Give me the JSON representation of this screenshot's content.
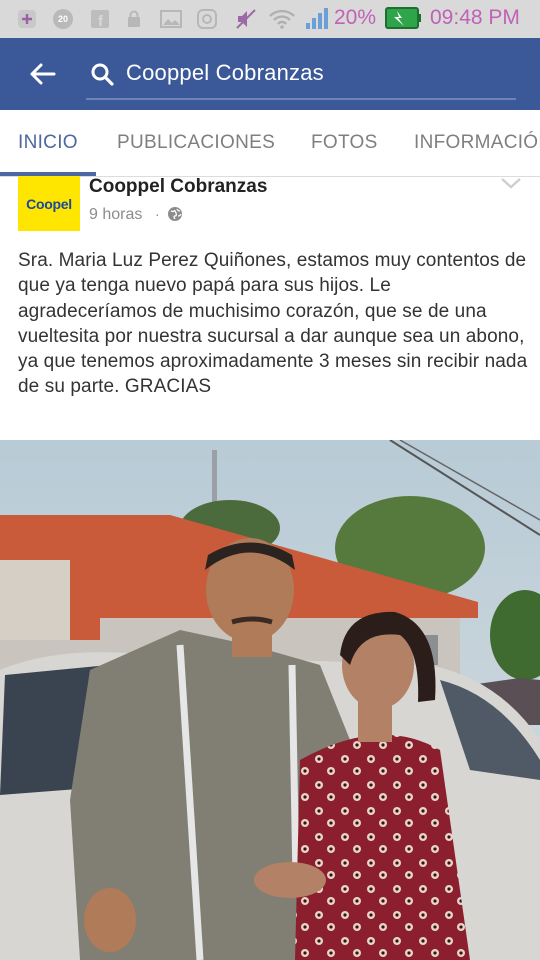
{
  "status_bar": {
    "notif_badge": "20",
    "battery_percent": "20%",
    "time": "09:48 PM",
    "icons": [
      "plus-icon",
      "badge-icon",
      "facebook-icon",
      "lock-icon",
      "image-icon",
      "instagram-icon",
      "mute-icon",
      "wifi-icon",
      "signal-icon",
      "battery-icon"
    ]
  },
  "app_bar": {
    "search_text": "Cooppel Cobranzas",
    "color": "#3b5998"
  },
  "tabs": [
    {
      "label": "INICIO",
      "active": true
    },
    {
      "label": "PUBLICACIONES",
      "active": false
    },
    {
      "label": "FOTOS",
      "active": false
    },
    {
      "label": "INFORMACIÓN",
      "active": false
    }
  ],
  "post": {
    "page_name": "Cooppel Cobranzas",
    "logo_text": "Coopel",
    "time": "9 horas",
    "separator": "·",
    "body": "Sra. Maria Luz Perez Quiñones, estamos muy contentos de que ya tenga nuevo papá para sus hijos. Le agradeceríamos de muchisimo corazón, que se de una vueltesita por nuestra sucursal a dar aunque sea un abono, ya que tenemos aproximadamente 3 meses sin recibir nada de su parte. GRACIAS"
  }
}
